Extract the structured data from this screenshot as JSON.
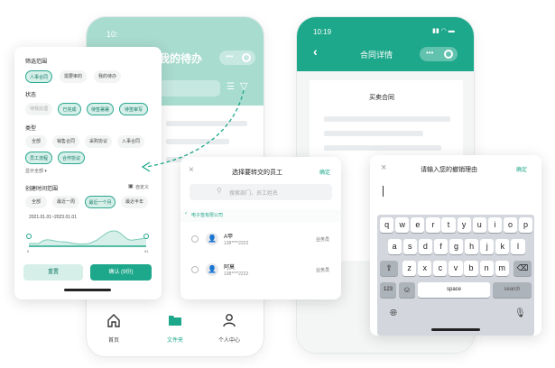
{
  "back_phone": {
    "time": "10:",
    "title": "我的待办",
    "tabs": [
      {
        "label": "首页",
        "icon": "home-icon"
      },
      {
        "label": "文件夹",
        "icon": "folder-icon"
      },
      {
        "label": "个人中心",
        "icon": "person-icon"
      }
    ]
  },
  "filter_panel": {
    "section_scope": "筛选范围",
    "scope_chips": [
      "人事合同",
      "需要审的",
      "我的待办"
    ],
    "section_status": "状态",
    "status_chips": [
      "待我处理",
      "已完成",
      "待签署署",
      "待签审写"
    ],
    "section_type": "类型",
    "type_chips": [
      "全部",
      "销售合同",
      "采购协议",
      "入事合同",
      "员工流程",
      "合作协议"
    ],
    "show_all": "显示全部 ▾",
    "section_time": "创建时间范围",
    "custom": "自定义",
    "time_chips": [
      "全部",
      "最近一周",
      "最近一个月",
      "最近半年"
    ],
    "date_range": "2021.01.01~2023.01.01",
    "slider_min": "0",
    "slider_max": "01",
    "reset_label": "重置",
    "confirm_label": "确认 (9份)"
  },
  "contract_phone": {
    "time": "10:19",
    "title": "合同详情",
    "doc_title": "买卖合同"
  },
  "transfer_dialog": {
    "title": "选择要转交的员工",
    "confirm": "确定",
    "search_placeholder": "搜索部门、员工姓名",
    "breadcrumb": "电子签有限公司",
    "employees": [
      {
        "name": "A甲",
        "phone": "138****2222",
        "role": "业务员"
      },
      {
        "name": "阿莫",
        "phone": "138****2222",
        "role": "业务员"
      }
    ]
  },
  "revoke_dialog": {
    "title": "请输入您的撤销理由",
    "confirm": "确定",
    "keyboard": {
      "row1": [
        "q",
        "w",
        "e",
        "r",
        "t",
        "y",
        "u",
        "i",
        "o",
        "p"
      ],
      "row2": [
        "a",
        "s",
        "d",
        "f",
        "g",
        "h",
        "j",
        "k",
        "l"
      ],
      "row3": [
        "z",
        "x",
        "c",
        "v",
        "b",
        "n",
        "m"
      ],
      "num": "123",
      "space": "space",
      "search": "search"
    }
  },
  "colors": {
    "accent": "#1ea88b",
    "accent_light": "#a8dccf",
    "chip_active_bg": "#d6efe9"
  }
}
